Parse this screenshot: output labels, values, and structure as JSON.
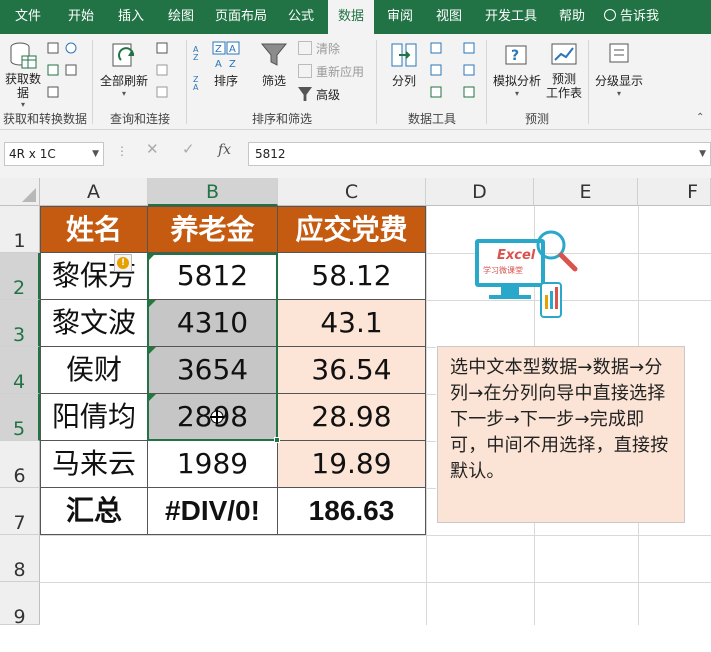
{
  "tabs": [
    {
      "label": "文件",
      "active": false
    },
    {
      "label": "开始",
      "active": false
    },
    {
      "label": "插入",
      "active": false
    },
    {
      "label": "绘图",
      "active": false
    },
    {
      "label": "页面布局",
      "active": false
    },
    {
      "label": "公式",
      "active": false
    },
    {
      "label": "数据",
      "active": true
    },
    {
      "label": "审阅",
      "active": false
    },
    {
      "label": "视图",
      "active": false
    },
    {
      "label": "开发工具",
      "active": false
    },
    {
      "label": "帮助",
      "active": false
    }
  ],
  "tell_me": "告诉我",
  "ribbon": {
    "get_data": "获取数据",
    "refresh_all": "全部刷新",
    "sort": "排序",
    "filter": "筛选",
    "clear": "清除",
    "reapply": "重新应用",
    "advanced": "高级",
    "text_to_columns": "分列",
    "what_if": "模拟分析",
    "forecast_sheet": "预测\n工作表",
    "outline": "分级显示",
    "groups": {
      "get_transform": "获取和转换数据",
      "queries": "查询和连接",
      "sort_filter": "排序和筛选",
      "data_tools": "数据工具",
      "forecast": "预测"
    }
  },
  "formula_bar": {
    "name_box": "4R x 1C",
    "value": "5812"
  },
  "columns": [
    "A",
    "B",
    "C",
    "D",
    "E",
    "F"
  ],
  "rows": [
    "1",
    "2",
    "3",
    "4",
    "5",
    "6",
    "7",
    "8",
    "9"
  ],
  "table": {
    "headers": [
      "姓名",
      "养老金",
      "应交党费"
    ],
    "rows": [
      [
        "黎保芳",
        "5812",
        "58.12"
      ],
      [
        "黎文波",
        "4310",
        "43.1"
      ],
      [
        "侯财",
        "3654",
        "36.54"
      ],
      [
        "阳倩均",
        "2898",
        "28.98"
      ],
      [
        "马来云",
        "1989",
        "19.89"
      ]
    ],
    "total": [
      "汇总",
      "#DIV/0!",
      "186.63"
    ]
  },
  "note": "选中文本型数据→数据→分列→在分列向导中直接选择下一步→下一步→完成即可，中间不用选择，直接按默认。",
  "logo": {
    "title": "Excel",
    "subtitle": "学习微课堂"
  },
  "colors": {
    "excel_green": "#217346",
    "header_orange": "#c55a11",
    "peach": "#fce4d6",
    "selection_grey": "#c6c6c6"
  }
}
